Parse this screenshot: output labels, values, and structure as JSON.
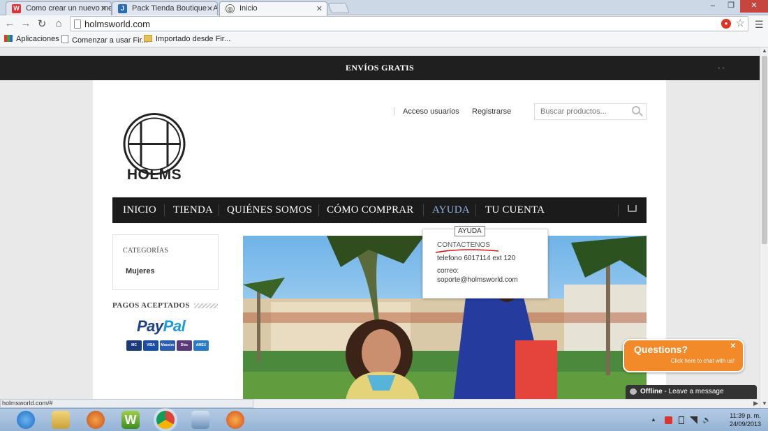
{
  "browser": {
    "tabs": [
      {
        "title": "Como crear un nuevo me",
        "favicon_color": "#d33"
      },
      {
        "title": "Pack Tienda Boutique - A",
        "favicon_color": "#2a6bb5"
      },
      {
        "title": "Inicio",
        "favicon_color": "#666"
      }
    ],
    "url": "holmsworld.com",
    "bookmarks": [
      "Aplicaciones",
      "Comenzar a usar Fir...",
      "Importado desde Fir..."
    ]
  },
  "site": {
    "top_bar": "ENVÍOS GRATIS",
    "top_bar_right": "- -",
    "logo_text": "HOLMS",
    "header_links": [
      "Acceso usuarios",
      "Registrarse"
    ],
    "search_placeholder": "Buscar productos...",
    "nav": [
      "INICIO",
      "TIENDA",
      "QUIÉNES SOMOS",
      "CÓMO COMPRAR",
      "AYUDA",
      "TU CUENTA"
    ],
    "tooltip": "AYUDA",
    "dropdown": {
      "title": "CONTACTENOS",
      "phone": "telefono 6017114 ext 120",
      "email_label": "correo:",
      "email": "soporte@holmsworld.com"
    },
    "sidebar": {
      "categories_title": "CATEGORÍAS",
      "category_items": [
        "Mujeres"
      ],
      "payments_title": "PAGOS ACEPTADOS",
      "paypal_p1": "Pay",
      "paypal_p2": "Pal",
      "cards": [
        "MC",
        "VISA",
        "Maestro",
        "Disc",
        "AMEX"
      ]
    },
    "chat": {
      "title": "Questions?",
      "subtitle": "Click here to chat with us!",
      "status": "Offline",
      "status_msg": " - Leave a message"
    }
  },
  "status_bar": "holmsworld.com/#",
  "taskbar": {
    "time": "11:39 p. m.",
    "date": "24/09/2013"
  }
}
